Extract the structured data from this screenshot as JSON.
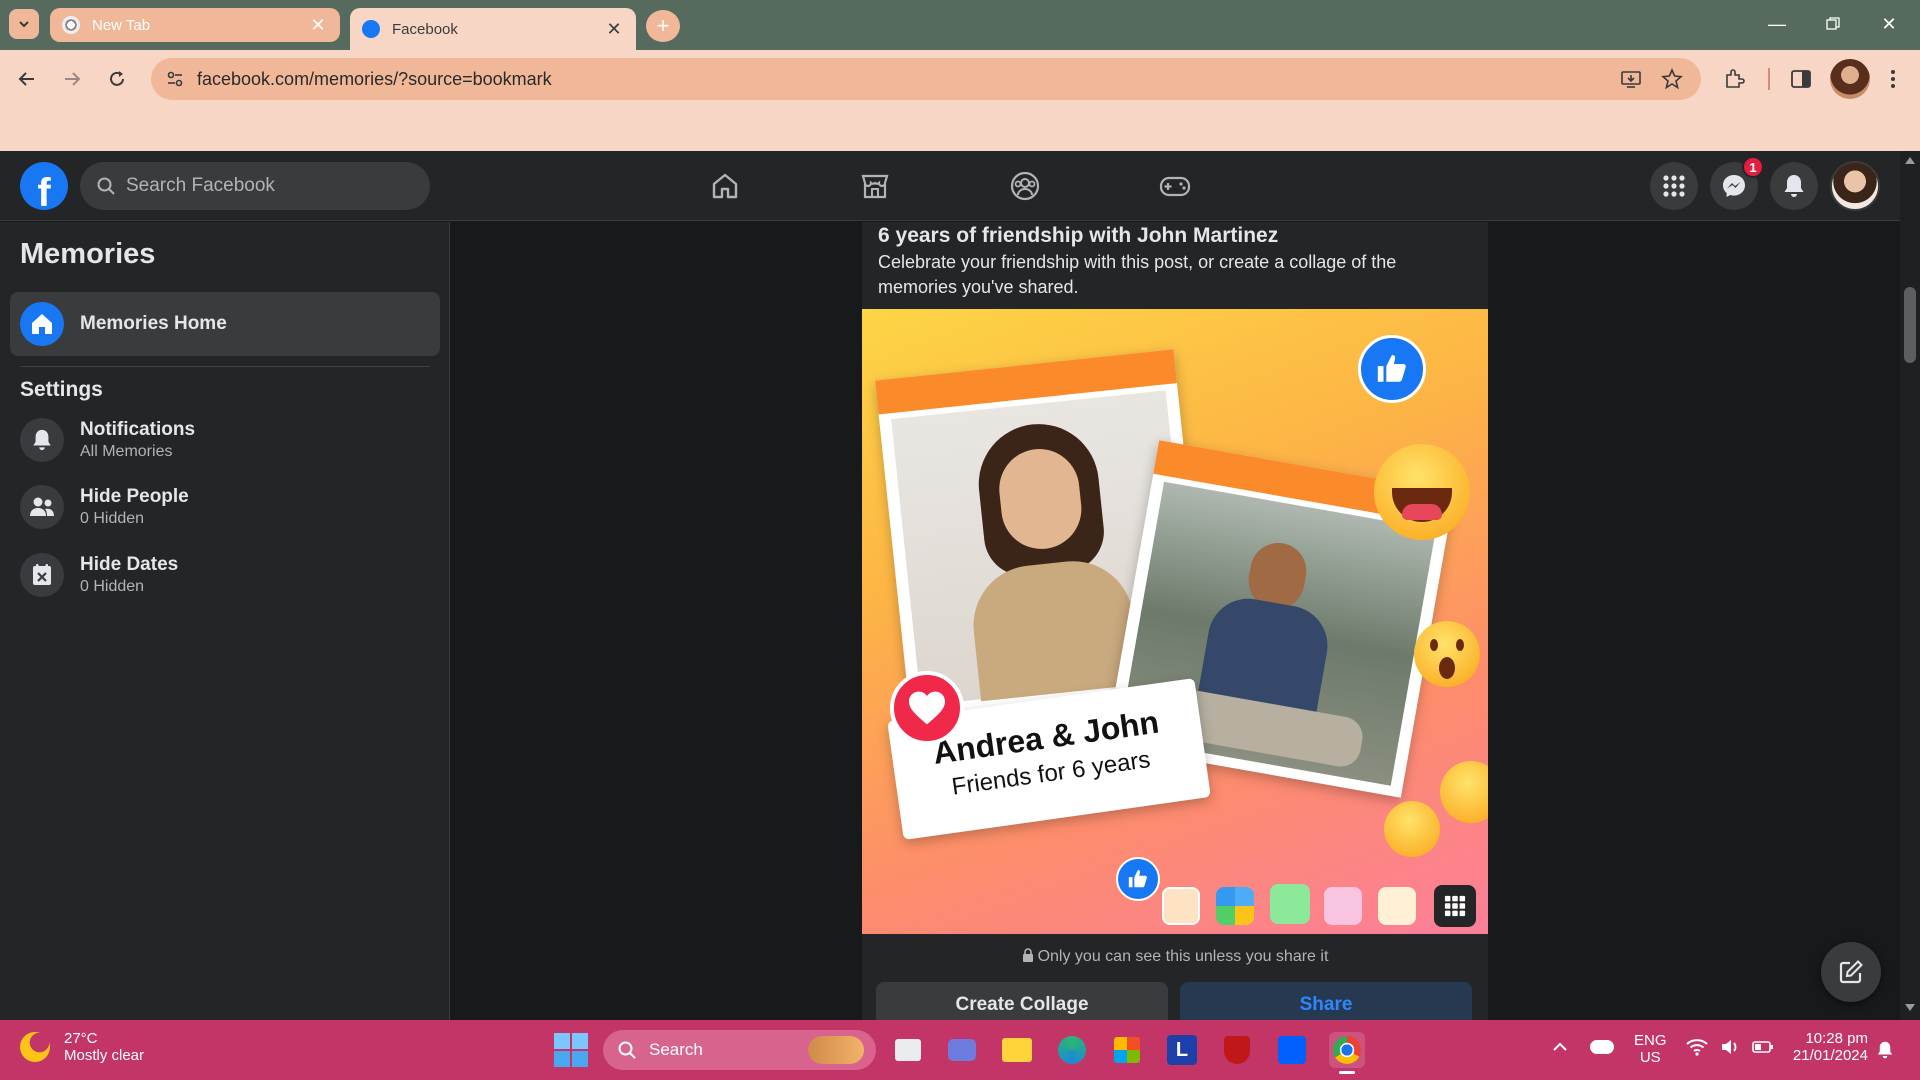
{
  "browser": {
    "tabs": [
      {
        "title": "New Tab",
        "active": false
      },
      {
        "title": "Facebook",
        "active": true
      }
    ],
    "url": "facebook.com/memories/?source=bookmark",
    "colors": {
      "tabbar": "#566b5e",
      "toolbar": "#f8d6c6",
      "omnibox": "#f0b898"
    }
  },
  "fb": {
    "search_placeholder": "Search Facebook",
    "messenger_badge": "1",
    "brand_color": "#1877f2"
  },
  "sidebar": {
    "title": "Memories",
    "home_label": "Memories Home",
    "settings_label": "Settings",
    "items": [
      {
        "label": "Notifications",
        "sub": "All Memories",
        "icon": "bell-icon"
      },
      {
        "label": "Hide People",
        "sub": "0 Hidden",
        "icon": "people-icon"
      },
      {
        "label": "Hide Dates",
        "sub": "0 Hidden",
        "icon": "calendar-x-icon"
      }
    ]
  },
  "card": {
    "title": "6 years of friendship with John Martinez",
    "description": "Celebrate your friendship with this post, or create a collage of the memories you've shared.",
    "image_names": "Andrea & John",
    "image_caption": "Friends for 6 years",
    "privacy_note": "Only you can see this unless you share it",
    "collage_button": "Create Collage",
    "share_button": "Share"
  },
  "taskbar": {
    "temperature": "27°C",
    "weather": "Mostly clear",
    "search_placeholder": "Search",
    "language": "ENG",
    "region": "US",
    "time": "10:28 pm",
    "date": "21/01/2024",
    "color": "#c33567"
  }
}
